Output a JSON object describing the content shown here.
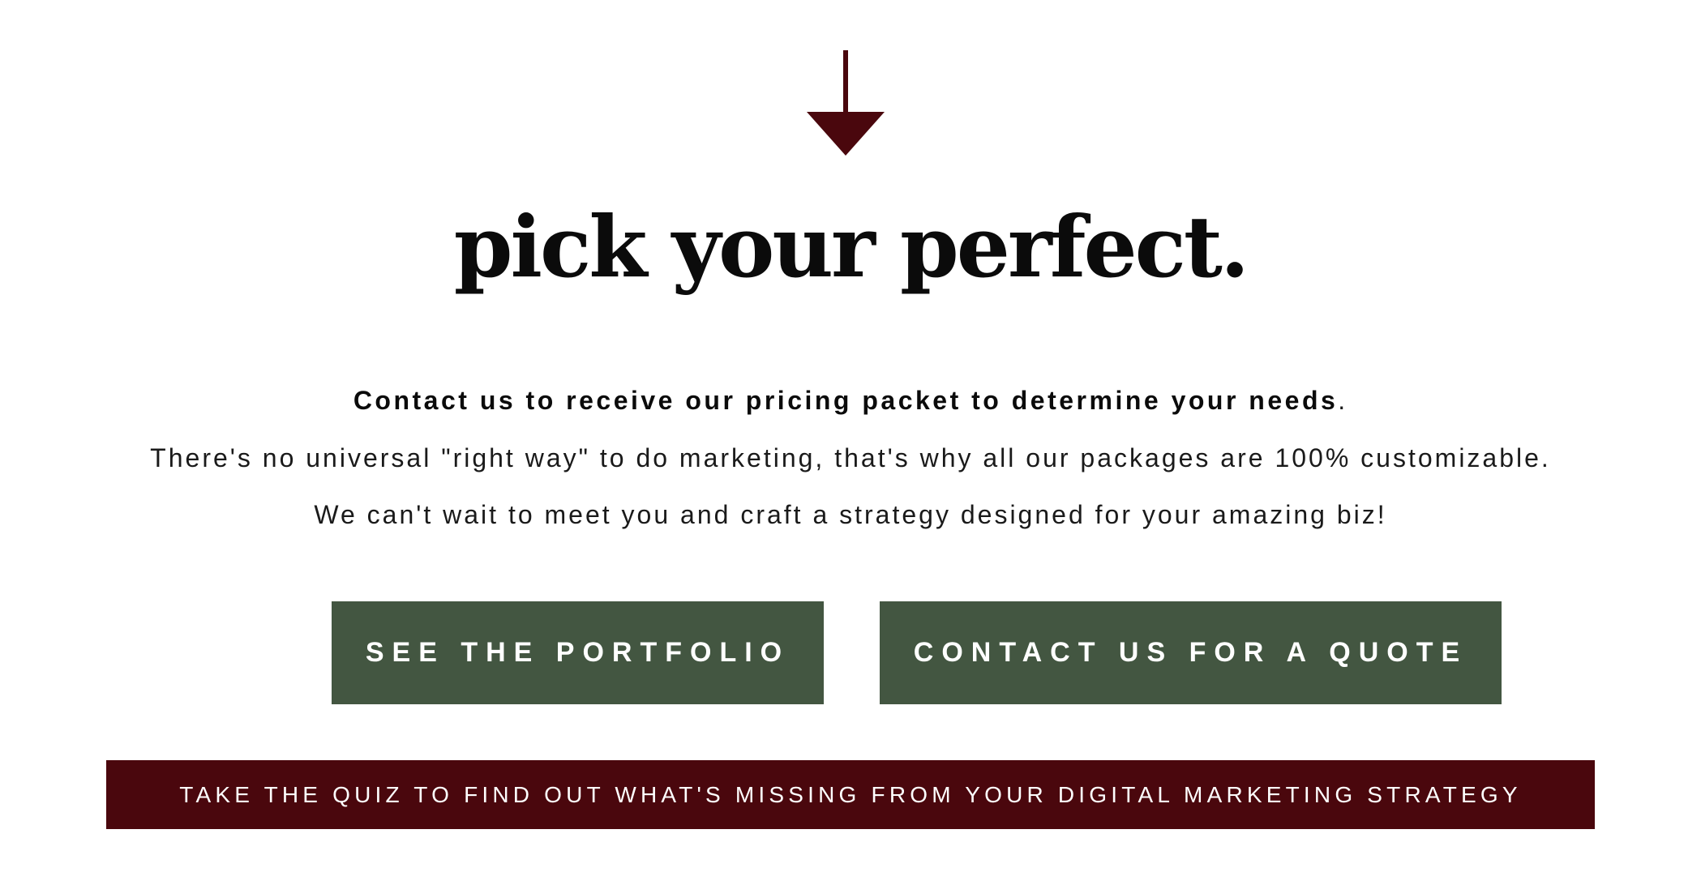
{
  "hero": {
    "icon": "arrow-down-icon",
    "title": "pick your perfect."
  },
  "intro": {
    "bold_text": "Contact us to receive our pricing packet to determine your needs",
    "bold_suffix": ".",
    "line2": "There's no universal \"right way\" to do marketing, that's why all our packages are 100% customizable.",
    "line3": "We can't wait to meet you and craft a strategy designed for your amazing biz!"
  },
  "buttons": {
    "portfolio_label": "SEE THE PORTFOLIO",
    "quote_label": "CONTACT US FOR A QUOTE",
    "quiz_label": "TAKE THE QUIZ TO FIND OUT WHAT'S MISSING FROM YOUR DIGITAL MARKETING STRATEGY"
  },
  "colors": {
    "accent_maroon": "#4a070d",
    "button_green": "#435641",
    "text_dark": "#0b0b0b",
    "background": "#ffffff"
  }
}
